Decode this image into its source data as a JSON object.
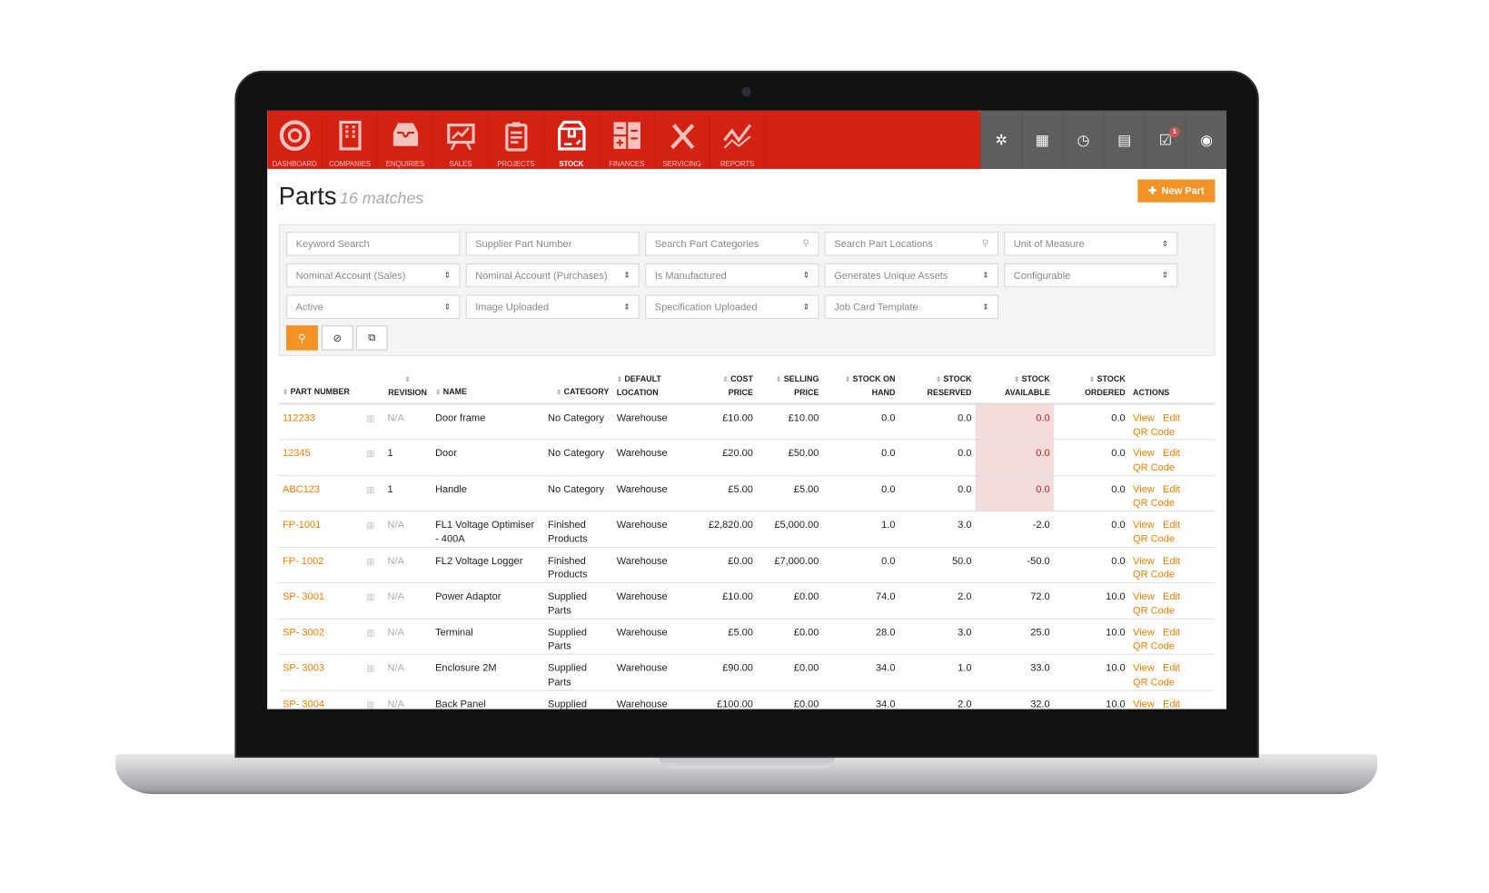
{
  "nav": {
    "items": [
      {
        "label": "DASHBOARD",
        "icon": "dashboard-icon"
      },
      {
        "label": "COMPANIES",
        "icon": "building-icon"
      },
      {
        "label": "ENQUIRIES",
        "icon": "inbox-icon"
      },
      {
        "label": "SALES",
        "icon": "presentation-chart-icon"
      },
      {
        "label": "PROJECTS",
        "icon": "clipboard-icon"
      },
      {
        "label": "STOCK",
        "icon": "box-icon",
        "active": true
      },
      {
        "label": "FINANCES",
        "icon": "calculator-icon"
      },
      {
        "label": "SERVICING",
        "icon": "tools-icon"
      },
      {
        "label": "REPORTS",
        "icon": "line-chart-icon"
      }
    ],
    "right_icons": [
      "settings-icon",
      "calendar-icon",
      "clock-icon",
      "chat-icon",
      "tasks-icon",
      "user-icon"
    ],
    "tasks_badge": "1"
  },
  "page": {
    "title": "Parts",
    "matches": "16 matches",
    "new_button": "New Part"
  },
  "filters": {
    "row1": [
      {
        "placeholder": "Keyword Search",
        "type": "text"
      },
      {
        "placeholder": "Supplier Part Number",
        "type": "text"
      },
      {
        "placeholder": "Search Part Categories",
        "type": "search"
      },
      {
        "placeholder": "Search Part Locations",
        "type": "search"
      },
      {
        "placeholder": "Unit of Measure",
        "type": "select"
      }
    ],
    "row2": [
      {
        "placeholder": "Nominal Account (Sales)",
        "type": "select"
      },
      {
        "placeholder": "Nominal Account (Purchases)",
        "type": "select"
      },
      {
        "placeholder": "Is Manufactured",
        "type": "select"
      },
      {
        "placeholder": "Generates Unique Assets",
        "type": "select"
      },
      {
        "placeholder": "Configurable",
        "type": "select"
      }
    ],
    "row3": [
      {
        "placeholder": "Active",
        "type": "select"
      },
      {
        "placeholder": "Image Uploaded",
        "type": "select"
      },
      {
        "placeholder": "Specification Uploaded",
        "type": "select"
      },
      {
        "placeholder": "Job Card Template",
        "type": "select"
      }
    ]
  },
  "table": {
    "headers": {
      "part_number": "PART NUMBER",
      "revision": "REVISION",
      "name": "NAME",
      "category": "CATEGORY",
      "location_1": "DEFAULT",
      "location_2": "LOCATION",
      "cost_1": "COST",
      "cost_2": "PRICE",
      "sell_1": "SELLING",
      "sell_2": "PRICE",
      "hand_1": "STOCK ON",
      "hand_2": "HAND",
      "res_1": "STOCK",
      "res_2": "RESERVED",
      "avail_1": "STOCK",
      "avail_2": "AVAILABLE",
      "ord_1": "STOCK",
      "ord_2": "ORDERED",
      "actions": "ACTIONS"
    },
    "actions": {
      "view": "View",
      "edit": "Edit",
      "qr": "QR Code"
    },
    "rows": [
      {
        "part": "112233",
        "rev": "N/A",
        "name": "Door frame",
        "cat": "No Category",
        "loc": "Warehouse",
        "cost": "£10.00",
        "sell": "£10.00",
        "hand": "0.0",
        "res": "0.0",
        "avail": "0.0",
        "ord": "0.0"
      },
      {
        "part": "12345",
        "rev": "1",
        "name": "Door",
        "cat": "No Category",
        "loc": "Warehouse",
        "cost": "£20.00",
        "sell": "£50.00",
        "hand": "0.0",
        "res": "0.0",
        "avail": "0.0",
        "ord": "0.0"
      },
      {
        "part": "ABC123",
        "rev": "1",
        "name": "Handle",
        "cat": "No Category",
        "loc": "Warehouse",
        "cost": "£5.00",
        "sell": "£5.00",
        "hand": "0.0",
        "res": "0.0",
        "avail": "0.0",
        "ord": "0.0"
      },
      {
        "part": "FP-1001",
        "rev": "N/A",
        "name": "FL1 Voltage Optimiser - 400A",
        "cat": "Finished Products",
        "loc": "Warehouse",
        "cost": "£2,820.00",
        "sell": "£5,000.00",
        "hand": "1.0",
        "res": "3.0",
        "avail": "-2.0",
        "ord": "0.0"
      },
      {
        "part": "FP- 1002",
        "rev": "N/A",
        "name": "FL2 Voltage Logger",
        "cat": "Finished Products",
        "loc": "Warehouse",
        "cost": "£0.00",
        "sell": "£7,000.00",
        "hand": "0.0",
        "res": "50.0",
        "avail": "-50.0",
        "ord": "0.0"
      },
      {
        "part": "SP- 3001",
        "rev": "N/A",
        "name": "Power Adaptor",
        "cat": "Supplied Parts",
        "loc": "Warehouse",
        "cost": "£10.00",
        "sell": "£0.00",
        "hand": "74.0",
        "res": "2.0",
        "avail": "72.0",
        "ord": "10.0"
      },
      {
        "part": "SP- 3002",
        "rev": "N/A",
        "name": "Terminal",
        "cat": "Supplied Parts",
        "loc": "Warehouse",
        "cost": "£5.00",
        "sell": "£0.00",
        "hand": "28.0",
        "res": "3.0",
        "avail": "25.0",
        "ord": "10.0"
      },
      {
        "part": "SP- 3003",
        "rev": "N/A",
        "name": "Enclosure 2M",
        "cat": "Supplied Parts",
        "loc": "Warehouse",
        "cost": "£90.00",
        "sell": "£0.00",
        "hand": "34.0",
        "res": "1.0",
        "avail": "33.0",
        "ord": "10.0"
      },
      {
        "part": "SP- 3004",
        "rev": "N/A",
        "name": "Back Panel",
        "cat": "Supplied",
        "loc": "Warehouse",
        "cost": "£100.00",
        "sell": "£0.00",
        "hand": "34.0",
        "res": "2.0",
        "avail": "32.0",
        "ord": "10.0"
      }
    ]
  },
  "colors": {
    "brand_red": "#d42113",
    "accent_orange": "#f39325",
    "link_orange": "#f07d00",
    "available_highlight": "#f5dcdc"
  }
}
